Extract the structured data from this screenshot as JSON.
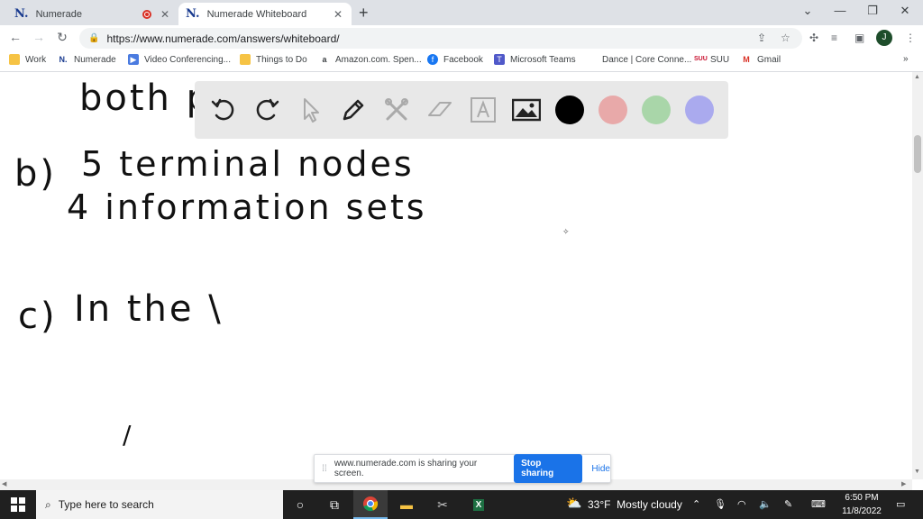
{
  "tabs": [
    {
      "favicon": "N.",
      "title": "Numerade",
      "recording": true,
      "active": false
    },
    {
      "favicon": "N.",
      "title": "Numerade Whiteboard",
      "recording": false,
      "active": true
    }
  ],
  "toolbar": {
    "url": "https://www.numerade.com/answers/whiteboard/",
    "profile_initial": "J"
  },
  "bookmarks": [
    {
      "label": "Work",
      "icon": "folder-icon"
    },
    {
      "label": "Numerade",
      "icon": "numerade-icon"
    },
    {
      "label": "Video Conferencing...",
      "icon": "video-icon"
    },
    {
      "label": "Things to Do",
      "icon": "folder-icon"
    },
    {
      "label": "Amazon.com. Spen...",
      "icon": "amazon-icon"
    },
    {
      "label": "Facebook",
      "icon": "facebook-icon"
    },
    {
      "label": "Microsoft Teams",
      "icon": "teams-icon"
    },
    {
      "label": "Dance | Core Conne...",
      "icon": "blank-icon"
    },
    {
      "label": "SUU",
      "icon": "suu-icon"
    },
    {
      "label": "Gmail",
      "icon": "gmail-icon"
    }
  ],
  "whiteboard": {
    "lines": {
      "partial_top": "both pl",
      "b_label": "b)",
      "b_line1": "5 terminal nodes",
      "b_line2": "4 information sets",
      "c_label": "c)",
      "c_line1": "In the \\",
      "stray_mark": "/"
    }
  },
  "drawbar": {
    "tools": [
      "undo-icon",
      "redo-icon",
      "pointer-icon",
      "pen-icon",
      "tools-icon",
      "eraser-icon",
      "text-icon",
      "image-icon"
    ],
    "colors": [
      "#000000",
      "#e8a9a9",
      "#a9d6a9",
      "#aaaaee"
    ]
  },
  "sharebar": {
    "message": "www.numerade.com is sharing your screen.",
    "stop_label": "Stop sharing",
    "hide_label": "Hide"
  },
  "taskbar": {
    "search_placeholder": "Type here to search",
    "weather": "33°F  Mostly cloudy",
    "time": "6:50 PM",
    "date": "11/8/2022"
  }
}
